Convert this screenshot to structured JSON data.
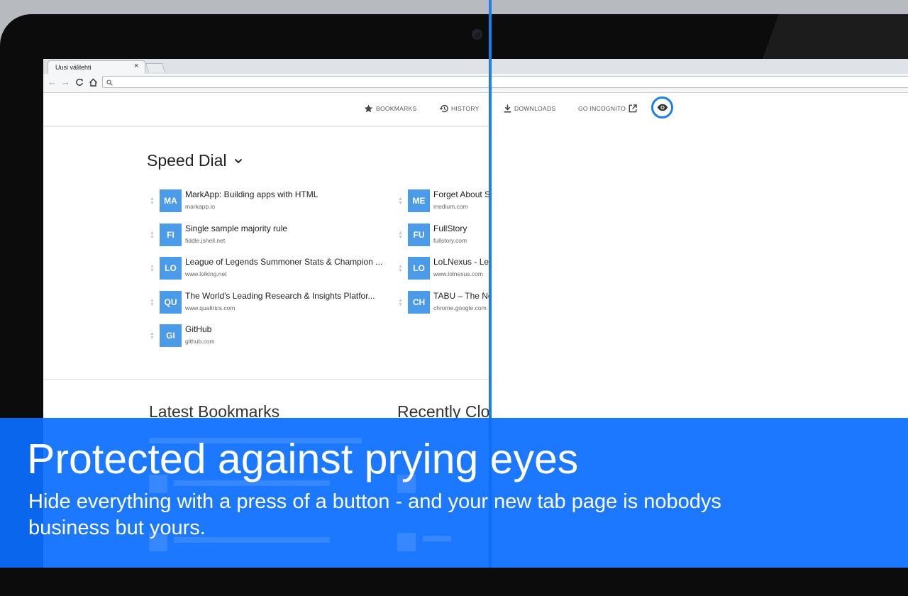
{
  "browser": {
    "tab_title": "Uusi välilehti",
    "tab_close": "×",
    "search_icon": "magnifier-icon"
  },
  "ntp": {
    "links": [
      {
        "label": "BOOKMARKS",
        "icon": "star-icon"
      },
      {
        "label": "HISTORY",
        "icon": "history-icon"
      },
      {
        "label": "DOWNLOADS",
        "icon": "download-icon"
      },
      {
        "label": "GO INCOGNITO",
        "icon": "open-external-icon"
      }
    ],
    "hide_button_icon": "eye-icon",
    "speed_dial_title": "Speed Dial",
    "speed_dial": [
      {
        "abbr": "MA",
        "name": "MarkApp: Building apps with HTML",
        "url": "markapp.io"
      },
      {
        "abbr": "FI",
        "name": "Single sample majority rule",
        "url": "fiddle.jshell.net"
      },
      {
        "abbr": "LO",
        "name": "League of Legends Summoner Stats & Champion ...",
        "url": "www.lolking.net"
      },
      {
        "abbr": "QU",
        "name": "The World's Leading Research & Insights Platfor...",
        "url": "www.qualtrics.com"
      },
      {
        "abbr": "GI",
        "name": "GitHub",
        "url": "github.com"
      },
      {
        "abbr": "ME",
        "name": "Forget About Sc",
        "url": "medium.com"
      },
      {
        "abbr": "FU",
        "name": "FullStory",
        "url": "fullstory.com"
      },
      {
        "abbr": "LO",
        "name": "LoLNexus - Lea",
        "url": "www.lolnexus.com"
      },
      {
        "abbr": "CH",
        "name": "TABU – The Ne",
        "url": "chrome.google.com"
      }
    ],
    "latest_bookmarks_title": "Latest Bookmarks",
    "recently_closed_title": "Recently Clo"
  },
  "promo": {
    "title": "Protected against prying eyes",
    "subtitle": "Hide everything with a press of a button - and your new tab page is nobodys business but yours."
  },
  "colors": {
    "accent": "#1f7ee6",
    "tile": "#4c9be8",
    "banner": "#0a6eff"
  }
}
